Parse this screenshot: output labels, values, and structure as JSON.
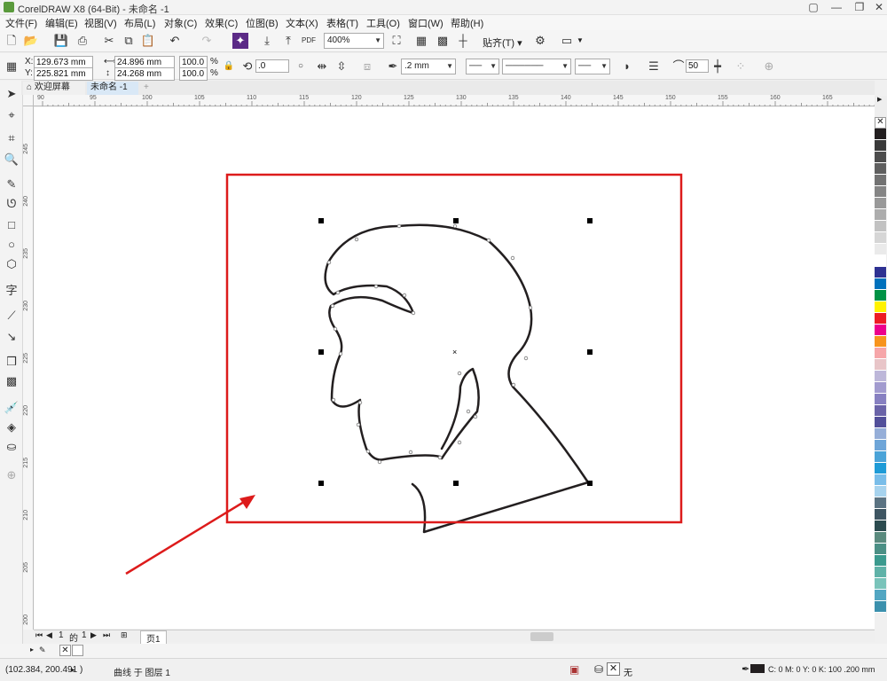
{
  "window": {
    "title": "CorelDRAW X8 (64-Bit) - 未命名 -1"
  },
  "menu": [
    "文件(F)",
    "编辑(E)",
    "视图(V)",
    "布局(L)",
    "对象(C)",
    "效果(C)",
    "位图(B)",
    "文本(X)",
    "表格(T)",
    "工具(O)",
    "窗口(W)",
    "帮助(H)"
  ],
  "toolbar1": {
    "zoom": "400%",
    "snap_label": "贴齐(T)",
    "pdf_label": "PDF"
  },
  "props": {
    "x": "129.673 mm",
    "y": "225.821 mm",
    "w": "24.896 mm",
    "h": "24.268 mm",
    "scale_x": "100.0",
    "scale_y": "100.0",
    "pct": "%",
    "x_label": "X:",
    "y_label": "Y:",
    "rotation": ".0",
    "outline_width": ".2 mm",
    "smoothing": "50"
  },
  "tabs": {
    "welcome": "欢迎屏幕",
    "document": "未命名 -1"
  },
  "ruler": {
    "h_ticks": [
      "90",
      "95",
      "100",
      "105",
      "110",
      "115",
      "120",
      "125",
      "130",
      "135",
      "140",
      "145",
      "150",
      "155",
      "160",
      "165"
    ],
    "v_ticks": [
      "245",
      "240",
      "235",
      "230",
      "225",
      "220",
      "215",
      "210",
      "205",
      "200"
    ]
  },
  "pages": {
    "current": "1",
    "of_label": "的",
    "total": "1",
    "page_tab": "页1"
  },
  "status": {
    "coords": "(102.384, 200.491 )",
    "object_info": "曲线 于 图层 1",
    "fill_none": "无",
    "outline_info": "C: 0 M: 0 Y: 0 K: 100  .200 mm"
  },
  "palette_colors": [
    "#231f20",
    "#3a3a3a",
    "#4d4d4d",
    "#5f5f5f",
    "#727272",
    "#858585",
    "#999999",
    "#adadad",
    "#c2c2c2",
    "#d6d6d6",
    "#eaeaea",
    "#ffffff",
    "#2e3192",
    "#0071bc",
    "#009245",
    "#fff200",
    "#ed1c24",
    "#ec008c",
    "#f7941d",
    "#f6a6a9",
    "#e8c5c8",
    "#bdb7d9",
    "#a29bcf",
    "#8780c1",
    "#6a63a8",
    "#524f9a",
    "#95aed8",
    "#6ea5d8",
    "#4aa3d8",
    "#1e9bd7",
    "#79bde9",
    "#a7d3ee",
    "#5b7382",
    "#3e5562",
    "#2b4b4f",
    "#5a8a7e",
    "#4b8f85",
    "#3b9a8e",
    "#5fb2a8",
    "#79c3ba",
    "#52a6c2",
    "#3b90ad"
  ],
  "accent": "#dd1b1b"
}
